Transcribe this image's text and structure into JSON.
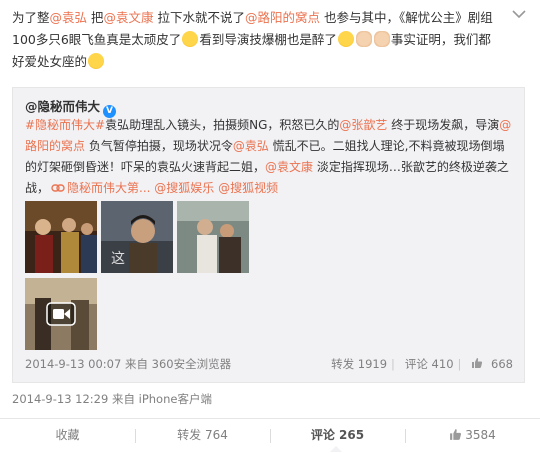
{
  "post": {
    "p1": "为了整",
    "m1": "@袁弘",
    "p2": " 把",
    "m2": "@袁文康",
    "p3": " 拉下水就不说了",
    "m3": "@路阳的窝点",
    "p4": " 也参与其中，《解忧公主》剧组100多只6眼飞鱼真是太顽皮了",
    "p5": "看到导演技爆棚也是醉了",
    "p6": "事实证明，我们都好爱处女座的",
    "time": "2014-9-13 12:29",
    "source": "来自 iPhone客户端"
  },
  "retweet": {
    "user": "@隐秘而伟大",
    "topic": "#隐秘而伟大#",
    "t1": "袁弘助理乱入镜头，拍摄频NG，积怒已久的",
    "m1": "@张歆艺",
    "t2": " 终于现场发飙，导演",
    "m2": "@路阳的窝点",
    "t3": " 负气暂停拍摄，现场状况令",
    "m3": "@袁弘",
    "t4": " 慌乱不已。二姐找人理论,不料竟被现场倒塌的灯架砸倒昏迷！吓呆的袁弘火速背起二姐，",
    "m4": "@袁文康",
    "t5": " 淡定指挥现场…张歆艺的终极逆袭之战，",
    "link": "隐秘而伟大第...",
    "m5": "@搜狐娱乐",
    "m6": "@搜狐视频",
    "time": "2014-9-13 00:07",
    "source": "来自 360安全浏览器",
    "repost": "转发 1919",
    "comment": "评论 410",
    "like": "668"
  },
  "bottom": {
    "fav": "收藏",
    "repost": "转发 764",
    "comment": "评论 265",
    "like": "3584"
  },
  "colors": {
    "mention": "#eb7350",
    "background": "#f2f2f5",
    "badge": "#1e90ff"
  },
  "icons": [
    "chevron-down-icon",
    "verified-badge-icon",
    "link-icon",
    "video-play-icon",
    "thumbs-up-icon"
  ]
}
